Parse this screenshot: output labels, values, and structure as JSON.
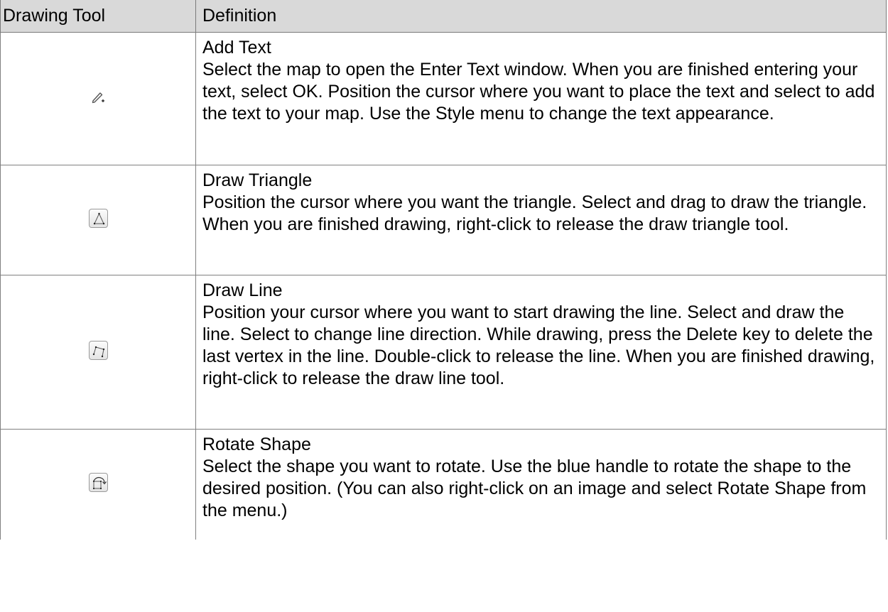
{
  "table": {
    "headers": {
      "tool": "Drawing Tool",
      "definition": "Definition"
    },
    "rows": [
      {
        "icon": "pencil-plus-icon",
        "name": "Add Text",
        "desc_parts": [
          "Select the map to open the Enter Text window. When you are finished entering your text, select ",
          "OK",
          ". Position the cursor where you want to place the text and select to add the text to your map. Use the ",
          "Style",
          " menu to change the text appearance."
        ]
      },
      {
        "icon": "triangle-icon",
        "name": "Draw Triangle",
        "description": "Position the cursor where you want the triangle. Select and drag to draw the triangle. When you are finished drawing, right-click to release the draw triangle tool."
      },
      {
        "icon": "polyline-icon",
        "name": "Draw Line",
        "description": "Position your cursor where you want to start drawing the line. Select and draw the line. Select to change line direction. While drawing, press the Delete key to delete the last vertex in the line. Double-click to release the line. When you are finished drawing, right-click to release the draw line tool."
      },
      {
        "icon": "rotate-shape-icon",
        "name": "Rotate Shape",
        "description": "Select the shape you want to rotate. Use the blue handle to rotate the shape to the desired position. (You can also right-click on an image and select Rotate Shape from the menu.)"
      }
    ]
  }
}
